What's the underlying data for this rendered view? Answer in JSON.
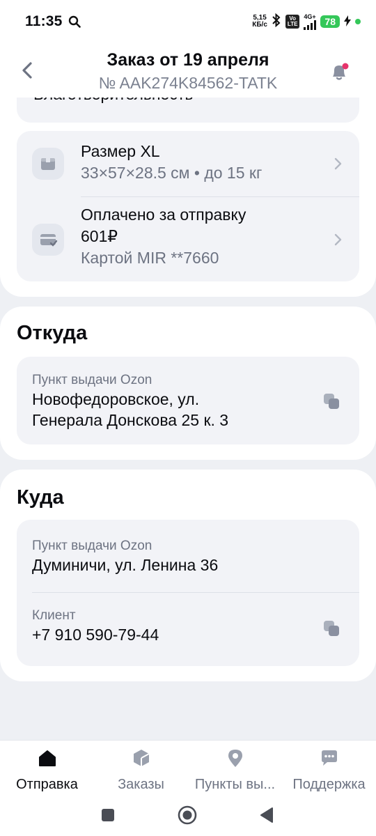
{
  "status_bar": {
    "time": "11:35",
    "net_speed_top": "5,15",
    "net_speed_bottom": "КБ/с",
    "volte_top": "Vo",
    "volte_bottom": "LTE",
    "network": "4G+",
    "battery": "78",
    "icons": [
      "search-icon",
      "bluetooth-icon",
      "signal-icon",
      "battery-icon",
      "charging-icon"
    ]
  },
  "header": {
    "title": "Заказ от 19 апреля",
    "order_number": "№ AAK274K84562-TATK",
    "icons": [
      "chevron-left-icon",
      "bell-icon"
    ],
    "notification_dot_color": "#e6336b"
  },
  "top_section": {
    "cut_text": "Благотворительность"
  },
  "package": {
    "size": {
      "title": "Размер XL",
      "details": "33×57×28.5 см • до 15 кг",
      "icon": "box-icon"
    },
    "payment": {
      "title": "Оплачено за отправку",
      "amount": "601₽",
      "method": "Картой MIR **7660",
      "icon": "card-check-icon"
    }
  },
  "from": {
    "title": "Откуда",
    "caption": "Пункт выдачи Ozon",
    "address_line1": "Новофедоровское, ул.",
    "address_line2": "Генерала Донскова 25 к. 3",
    "icon": "copy-icon"
  },
  "to": {
    "title": "Куда",
    "point_caption": "Пункт выдачи Ozon",
    "point_address": "Думиничи, ул. Ленина 36",
    "client_caption": "Клиент",
    "client_phone": "+7 910 590-79-44",
    "icon": "copy-icon"
  },
  "bottom_nav": {
    "items": [
      {
        "label": "Отправка",
        "icon": "home-icon",
        "active": true
      },
      {
        "label": "Заказы",
        "icon": "package-icon",
        "active": false
      },
      {
        "label": "Пункты вы...",
        "icon": "location-pin-icon",
        "active": false
      },
      {
        "label": "Поддержка",
        "icon": "chat-icon",
        "active": false
      }
    ]
  },
  "colors": {
    "background": "#eef0f4",
    "card": "#ffffff",
    "inner_card": "#f2f3f7",
    "text_primary": "#0b0c10",
    "text_secondary": "#6d7382",
    "battery": "#34c759"
  }
}
